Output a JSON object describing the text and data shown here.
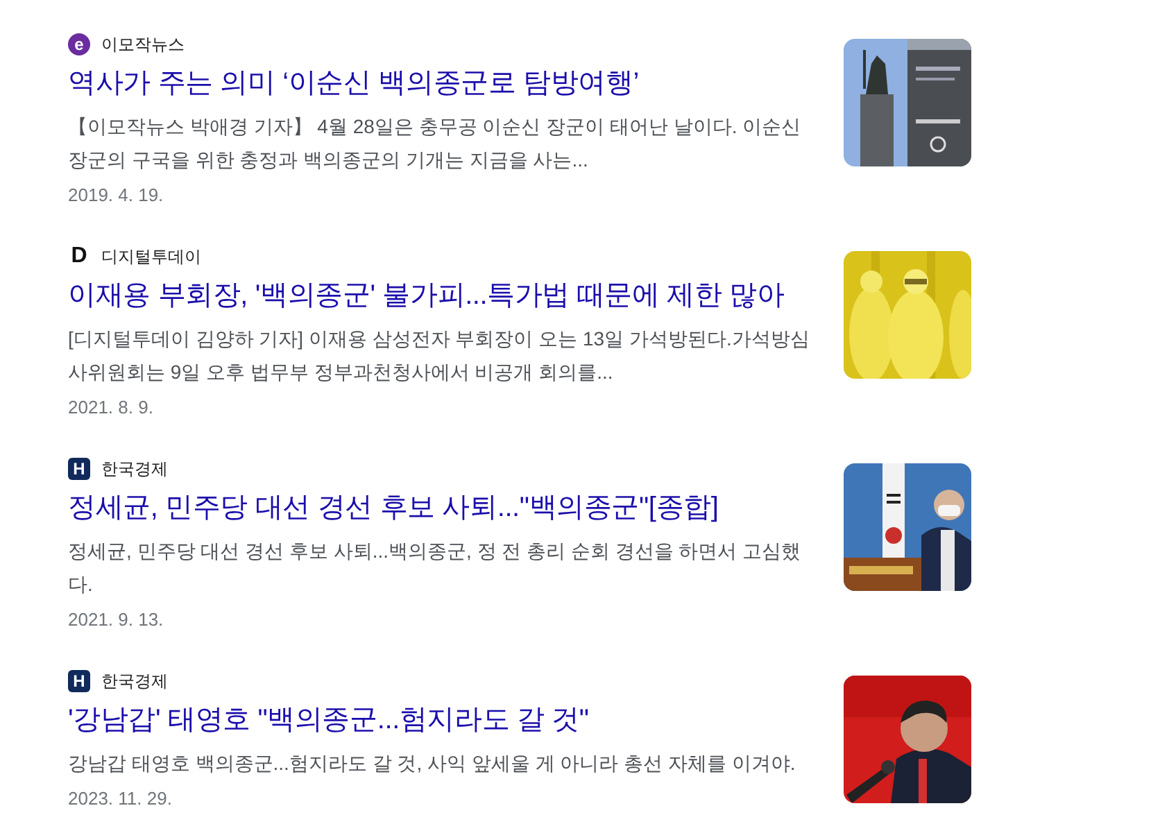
{
  "articles": [
    {
      "source": {
        "name": "이모작뉴스",
        "kind": "round",
        "logo_text": "e",
        "color": "#6a2c9e"
      },
      "title": "역사가 주는 의미 ‘이순신 백의종군로 탐방여행’",
      "snippet": "【이모작뉴스 박애경 기자】 4월 28일은 충무공 이순신 장군이 태어난 날이다. 이순신 장군의 구국을 위한 충정과 백의종군의 기개는 지금을 사는...",
      "date": "2019. 4. 19."
    },
    {
      "source": {
        "name": "디지털투데이",
        "kind": "plain",
        "logo_text": "D",
        "color": "#111111"
      },
      "title": "이재용 부회장, '백의종군' 불가피...특가법 때문에 제한 많아",
      "snippet": "[디지털투데이 김양하 기자] 이재용 삼성전자 부회장이 오는 13일 가석방된다.가석방심사위원회는 9일 오후 법무부 정부과천청사에서 비공개 회의를...",
      "date": "2021. 8. 9."
    },
    {
      "source": {
        "name": "한국경제",
        "kind": "square",
        "logo_text": "H",
        "color": "#102a5c"
      },
      "title": "정세균, 민주당 대선 경선 후보 사퇴...\"백의종군\"[종합]",
      "snippet": "정세균, 민주당 대선 경선 후보 사퇴...백의종군, 정 전 총리 순회 경선을 하면서 고심했다.",
      "date": "2021. 9. 13."
    },
    {
      "source": {
        "name": "한국경제",
        "kind": "square",
        "logo_text": "H",
        "color": "#102a5c"
      },
      "title": "'강남갑' 태영호 \"백의종군...험지라도 갈 것\"",
      "snippet": "강남갑 태영호 백의종군...험지라도 갈 것, 사익 앞세울 게 아니라 총선 자체를 이겨야.",
      "date": "2023. 11. 29."
    }
  ]
}
